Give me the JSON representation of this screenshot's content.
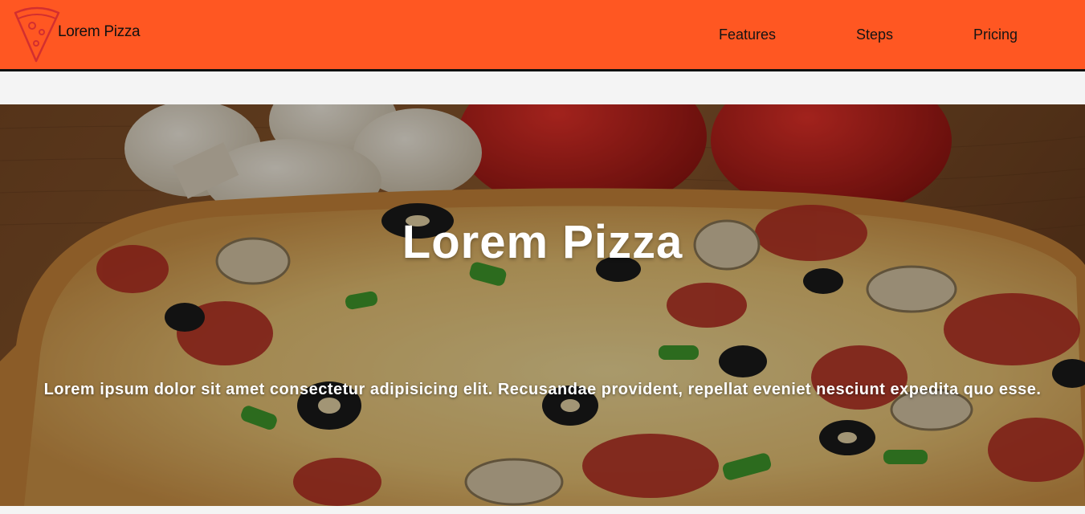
{
  "brand": {
    "logo_text": "Lorem Pizza",
    "logo_icon": "pizza-slice-icon"
  },
  "nav": {
    "items": [
      {
        "label": "Features"
      },
      {
        "label": "Steps"
      },
      {
        "label": "Pricing"
      }
    ]
  },
  "hero": {
    "title": "Lorem Pizza",
    "subtitle": "Lorem ipsum dolor sit amet consectetur adipisicing elit. Recusandae provident, repellat eveniet nesciunt expedita quo esse.",
    "background_image": "pizza-photo"
  },
  "colors": {
    "navbar": "#ff5722",
    "navbar_border": "#111111",
    "page_background": "#f4f4f4",
    "logo_icon": "#d32f2f",
    "hero_text": "#ffffff"
  }
}
